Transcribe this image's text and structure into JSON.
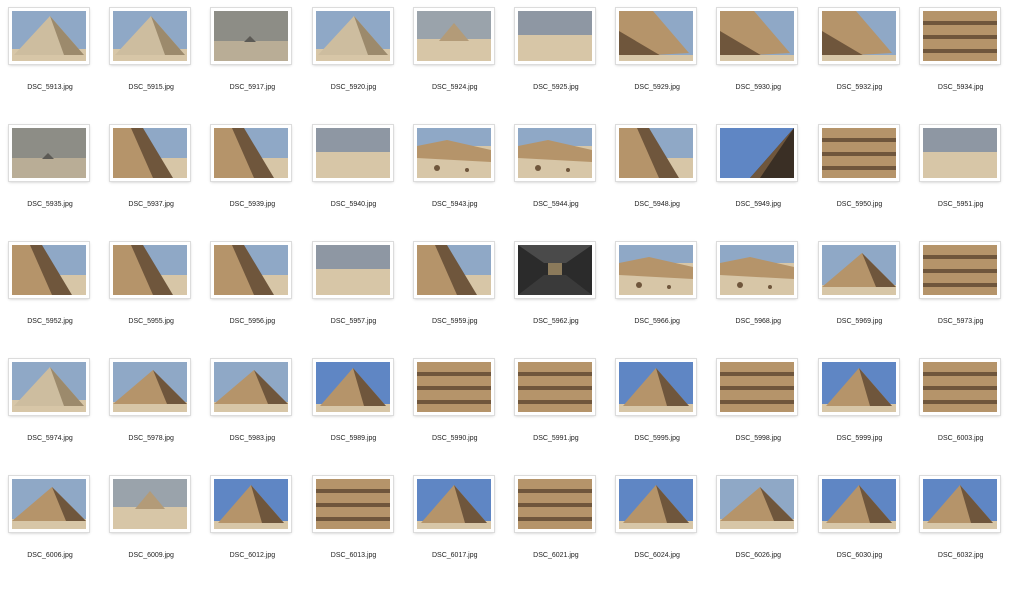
{
  "files": [
    {
      "name": "DSC_5913.jpg",
      "scene": "pyramid-close"
    },
    {
      "name": "DSC_5915.jpg",
      "scene": "pyramid-close"
    },
    {
      "name": "DSC_5917.jpg",
      "scene": "distant-haze"
    },
    {
      "name": "DSC_5920.jpg",
      "scene": "pyramid-close"
    },
    {
      "name": "DSC_5924.jpg",
      "scene": "pyramid-distant"
    },
    {
      "name": "DSC_5925.jpg",
      "scene": "desert-flat"
    },
    {
      "name": "DSC_5929.jpg",
      "scene": "pyramid-corner"
    },
    {
      "name": "DSC_5930.jpg",
      "scene": "pyramid-corner"
    },
    {
      "name": "DSC_5932.jpg",
      "scene": "pyramid-corner"
    },
    {
      "name": "DSC_5934.jpg",
      "scene": "stone-face"
    },
    {
      "name": "DSC_5935.jpg",
      "scene": "distant-haze"
    },
    {
      "name": "DSC_5937.jpg",
      "scene": "pyramid-edge"
    },
    {
      "name": "DSC_5939.jpg",
      "scene": "pyramid-edge"
    },
    {
      "name": "DSC_5940.jpg",
      "scene": "desert-flat"
    },
    {
      "name": "DSC_5943.jpg",
      "scene": "rubble"
    },
    {
      "name": "DSC_5944.jpg",
      "scene": "rubble"
    },
    {
      "name": "DSC_5948.jpg",
      "scene": "pyramid-edge"
    },
    {
      "name": "DSC_5949.jpg",
      "scene": "shadow-edge"
    },
    {
      "name": "DSC_5950.jpg",
      "scene": "stone-face"
    },
    {
      "name": "DSC_5951.jpg",
      "scene": "desert-flat"
    },
    {
      "name": "DSC_5952.jpg",
      "scene": "pyramid-edge"
    },
    {
      "name": "DSC_5955.jpg",
      "scene": "pyramid-edge"
    },
    {
      "name": "DSC_5956.jpg",
      "scene": "pyramid-edge"
    },
    {
      "name": "DSC_5957.jpg",
      "scene": "desert-flat"
    },
    {
      "name": "DSC_5959.jpg",
      "scene": "pyramid-edge"
    },
    {
      "name": "DSC_5962.jpg",
      "scene": "tunnel"
    },
    {
      "name": "DSC_5966.jpg",
      "scene": "rubble"
    },
    {
      "name": "DSC_5968.jpg",
      "scene": "rubble"
    },
    {
      "name": "DSC_5969.jpg",
      "scene": "pyramid-side"
    },
    {
      "name": "DSC_5973.jpg",
      "scene": "stone-face"
    },
    {
      "name": "DSC_5974.jpg",
      "scene": "pyramid-close"
    },
    {
      "name": "DSC_5978.jpg",
      "scene": "pyramid-side"
    },
    {
      "name": "DSC_5983.jpg",
      "scene": "pyramid-side"
    },
    {
      "name": "DSC_5989.jpg",
      "scene": "pyramid-full"
    },
    {
      "name": "DSC_5990.jpg",
      "scene": "stone-face"
    },
    {
      "name": "DSC_5991.jpg",
      "scene": "stone-face"
    },
    {
      "name": "DSC_5995.jpg",
      "scene": "pyramid-full"
    },
    {
      "name": "DSC_5998.jpg",
      "scene": "stone-face"
    },
    {
      "name": "DSC_5999.jpg",
      "scene": "pyramid-full"
    },
    {
      "name": "DSC_6003.jpg",
      "scene": "stone-face"
    },
    {
      "name": "DSC_6006.jpg",
      "scene": "pyramid-side"
    },
    {
      "name": "DSC_6009.jpg",
      "scene": "pyramid-distant"
    },
    {
      "name": "DSC_6012.jpg",
      "scene": "pyramid-full"
    },
    {
      "name": "DSC_6013.jpg",
      "scene": "stone-face"
    },
    {
      "name": "DSC_6017.jpg",
      "scene": "pyramid-full"
    },
    {
      "name": "DSC_6021.jpg",
      "scene": "stone-face"
    },
    {
      "name": "DSC_6024.jpg",
      "scene": "pyramid-full"
    },
    {
      "name": "DSC_6026.jpg",
      "scene": "pyramid-side"
    },
    {
      "name": "DSC_6030.jpg",
      "scene": "pyramid-full"
    },
    {
      "name": "DSC_6032.jpg",
      "scene": "pyramid-full"
    }
  ],
  "colors": {
    "sky": "#8fa8c6",
    "sky_bright": "#5f86c4",
    "haze": "#8d8d86",
    "sand": "#d7c6a7",
    "stone": "#b5946a",
    "stone_dark": "#6f563c",
    "shadow": "#3a2f25",
    "tunnel": "#2b2b2b"
  }
}
